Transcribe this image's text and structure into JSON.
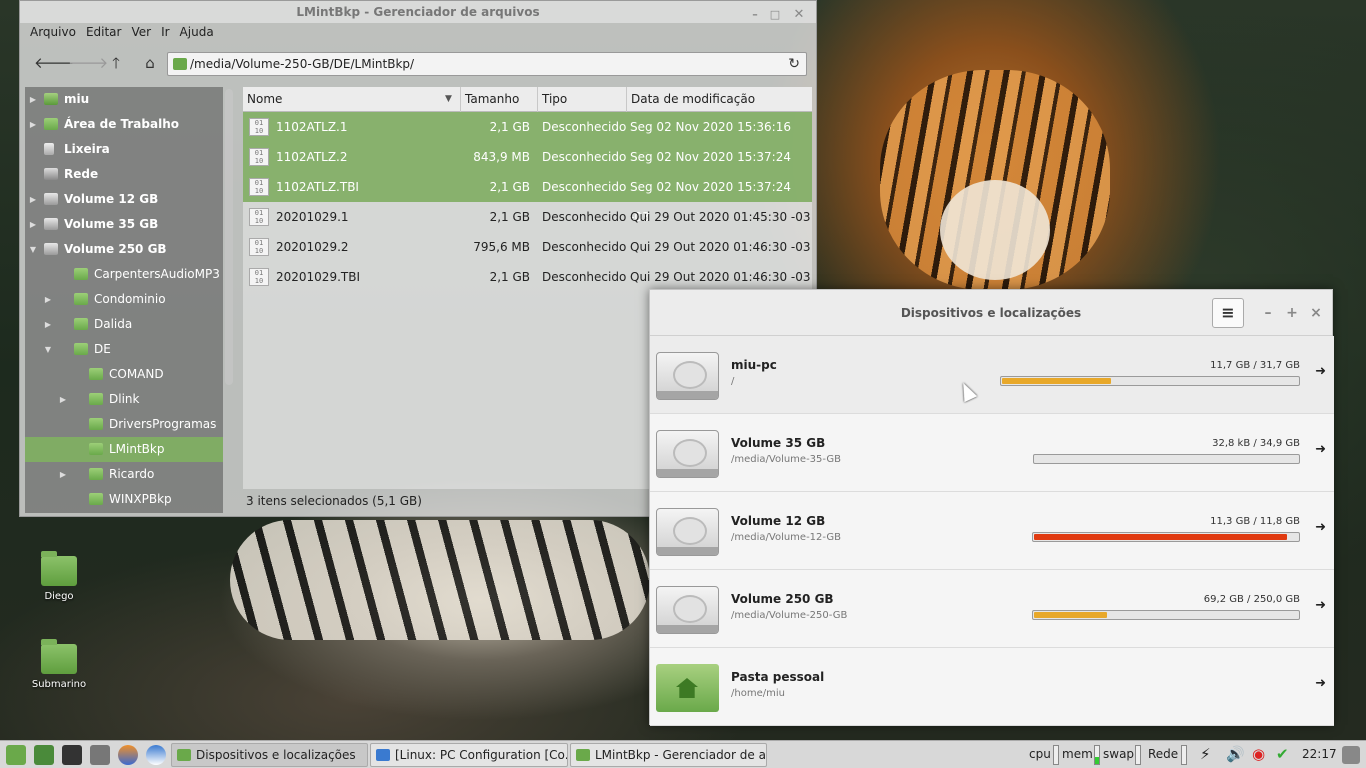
{
  "file_manager": {
    "title": "LMintBkp - Gerenciador de arquivos",
    "menu": [
      "Arquivo",
      "Editar",
      "Ver",
      "Ir",
      "Ajuda"
    ],
    "path": "/media/Volume-250-GB/DE/LMintBkp/",
    "sidebar": [
      {
        "label": "miu",
        "bold": true,
        "icon": "home-icon",
        "level": 0,
        "expander": "collapsed"
      },
      {
        "label": "Área de Trabalho",
        "bold": true,
        "icon": "desktop-folder-icon",
        "level": 0,
        "expander": "collapsed"
      },
      {
        "label": "Lixeira",
        "bold": true,
        "icon": "trash-icon",
        "level": 0,
        "expander": "none"
      },
      {
        "label": "Rede",
        "bold": true,
        "icon": "network-icon",
        "level": 0,
        "expander": "none"
      },
      {
        "label": "Volume 12 GB",
        "bold": true,
        "icon": "drive-icon",
        "level": 0,
        "expander": "collapsed"
      },
      {
        "label": "Volume 35 GB",
        "bold": true,
        "icon": "drive-icon",
        "level": 0,
        "expander": "collapsed"
      },
      {
        "label": "Volume 250 GB",
        "bold": true,
        "icon": "drive-icon",
        "level": 0,
        "expander": "expanded"
      },
      {
        "label": "CarpentersAudioMP3",
        "bold": false,
        "icon": "folder-icon",
        "level": 1,
        "expander": "none"
      },
      {
        "label": "Condominio",
        "bold": false,
        "icon": "folder-icon",
        "level": 1,
        "expander": "collapsed"
      },
      {
        "label": "Dalida",
        "bold": false,
        "icon": "folder-icon",
        "level": 1,
        "expander": "collapsed"
      },
      {
        "label": "DE",
        "bold": false,
        "icon": "folder-icon",
        "level": 1,
        "expander": "expanded"
      },
      {
        "label": "COMAND",
        "bold": false,
        "icon": "folder-icon",
        "level": 2,
        "expander": "none"
      },
      {
        "label": "Dlink",
        "bold": false,
        "icon": "folder-icon",
        "level": 2,
        "expander": "collapsed"
      },
      {
        "label": "DriversProgramas",
        "bold": false,
        "icon": "folder-icon",
        "level": 2,
        "expander": "none"
      },
      {
        "label": "LMintBkp",
        "bold": false,
        "icon": "folder-icon",
        "level": 2,
        "expander": "none",
        "selected": true
      },
      {
        "label": "Ricardo",
        "bold": false,
        "icon": "folder-icon",
        "level": 2,
        "expander": "collapsed"
      },
      {
        "label": "WINXPBkp",
        "bold": false,
        "icon": "folder-icon",
        "level": 2,
        "expander": "none"
      }
    ],
    "columns": [
      "Nome",
      "Tamanho",
      "Tipo",
      "Data de modificação"
    ],
    "files": [
      {
        "name": "1102ATLZ.1",
        "size": "2,1 GB",
        "type": "Desconhecido",
        "date": "Seg 02 Nov 2020 15:36:16 -03",
        "selected": true
      },
      {
        "name": "1102ATLZ.2",
        "size": "843,9 MB",
        "type": "Desconhecido",
        "date": "Seg 02 Nov 2020 15:37:24 -03",
        "selected": true
      },
      {
        "name": "1102ATLZ.TBI",
        "size": "2,1 GB",
        "type": "Desconhecido",
        "date": "Seg 02 Nov 2020 15:37:24 -03",
        "selected": true
      },
      {
        "name": "20201029.1",
        "size": "2,1 GB",
        "type": "Desconhecido",
        "date": "Qui 29 Out 2020 01:45:30 -03",
        "selected": false
      },
      {
        "name": "20201029.2",
        "size": "795,6 MB",
        "type": "Desconhecido",
        "date": "Qui 29 Out 2020 01:46:30 -03",
        "selected": false
      },
      {
        "name": "20201029.TBI",
        "size": "2,1 GB",
        "type": "Desconhecido",
        "date": "Qui 29 Out 2020 01:46:30 -03",
        "selected": false
      }
    ],
    "file_icon_text": "01\n10",
    "status": "3 itens selecionados (5,1 GB)"
  },
  "devices": {
    "title": "Dispositivos e localizações",
    "menu_glyph": "≡",
    "items": [
      {
        "name": "miu-pc",
        "path": "/",
        "usage": "11,7 GB / 31,7 GB",
        "fraction": 0.369,
        "bar_color": "#e8a82a",
        "icon": "hard-disk-icon"
      },
      {
        "name": "Volume 35 GB",
        "path": "/media/Volume-35-GB",
        "usage": "32,8 kB / 34,9 GB",
        "fraction": 0.0,
        "bar_color": "#e8a82a",
        "icon": "hard-disk-icon"
      },
      {
        "name": "Volume 12 GB",
        "path": "/media/Volume-12-GB",
        "usage": "11,3 GB / 11,8 GB",
        "fraction": 0.958,
        "bar_color": "#e03a10",
        "icon": "hard-disk-icon"
      },
      {
        "name": "Volume 250 GB",
        "path": "/media/Volume-250-GB",
        "usage": "69,2 GB / 250,0 GB",
        "fraction": 0.277,
        "bar_color": "#e8a82a",
        "icon": "hard-disk-icon"
      },
      {
        "name": "Pasta pessoal",
        "path": "/home/miu",
        "usage": "",
        "fraction": null,
        "bar_color": "",
        "icon": "home-folder-icon"
      }
    ]
  },
  "desktop_icons": [
    {
      "label": "Diego"
    },
    {
      "label": "Submarino"
    }
  ],
  "taskbar": {
    "tasks": [
      {
        "label": "Dispositivos e localizações",
        "active": true
      },
      {
        "label": "[Linux: PC Configuration [Co...",
        "active": false
      },
      {
        "label": "LMintBkp - Gerenciador de a...",
        "active": false
      }
    ],
    "tray": {
      "cpu": "cpu",
      "mem": "mem",
      "swap": "swap",
      "net": "Rede"
    },
    "clock": "22:17"
  }
}
